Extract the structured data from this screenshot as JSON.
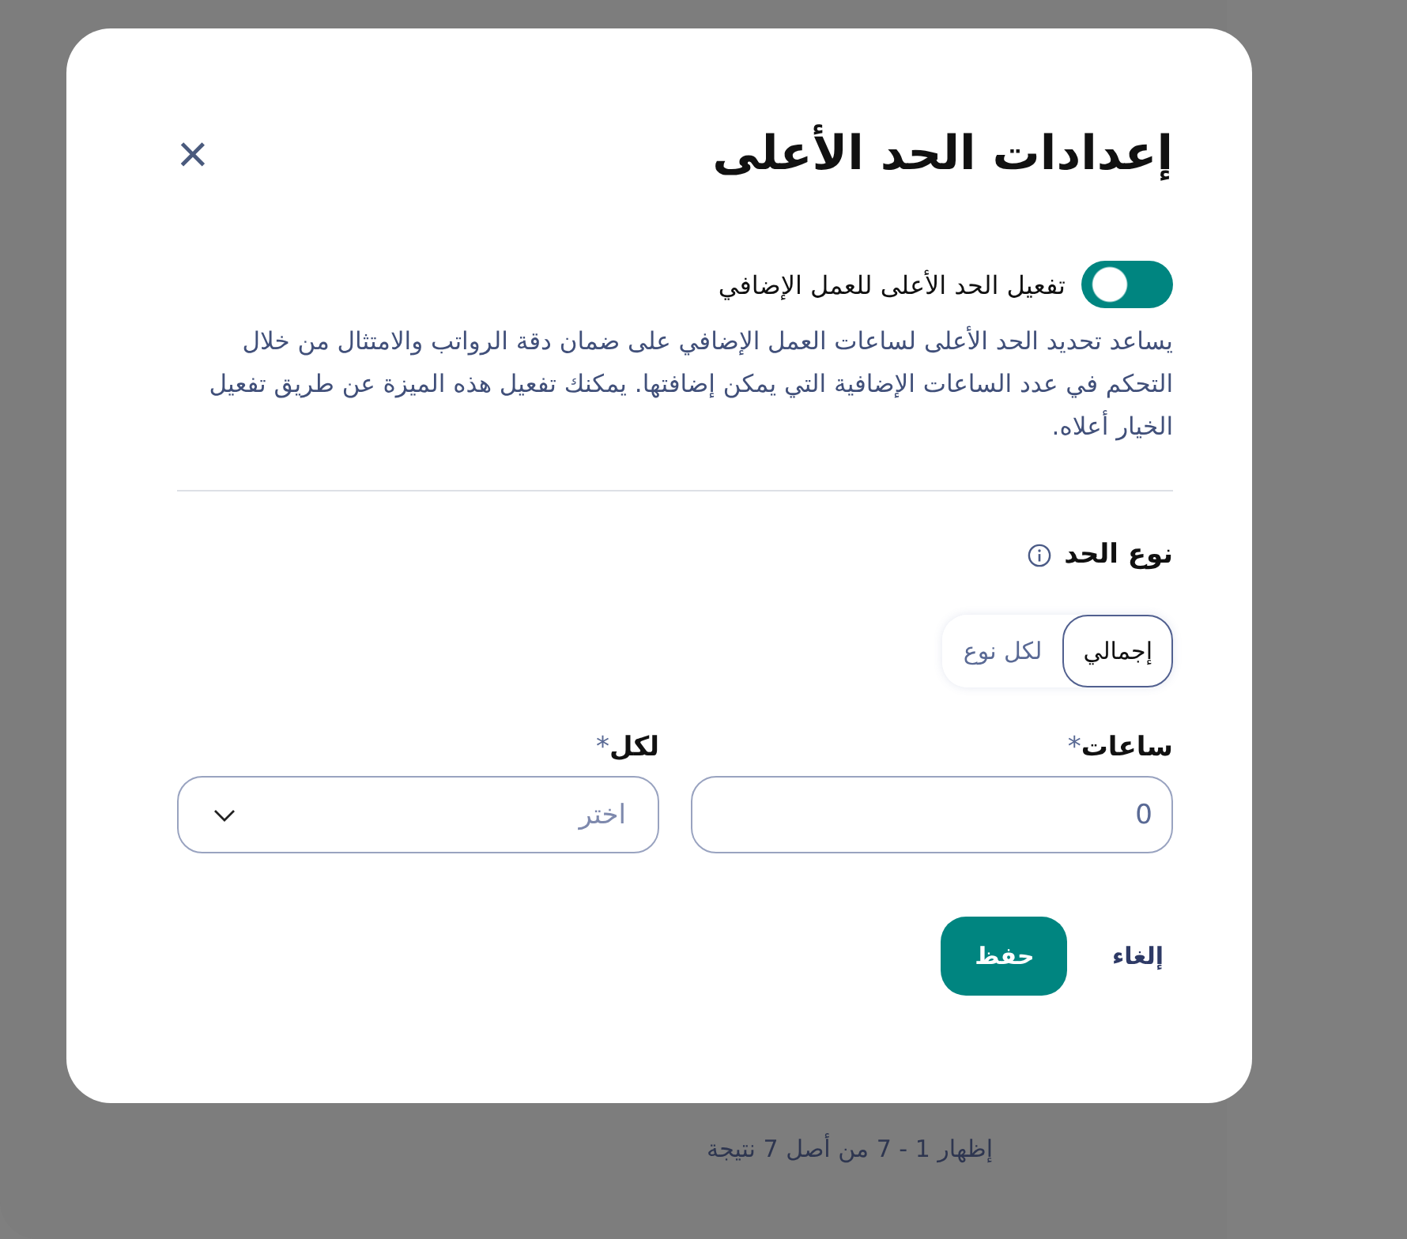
{
  "background": {
    "footer": "إظهار 1 - 7 من أصل 7 نتيجة"
  },
  "dialog": {
    "title": "إعدادات الحد الأعلى",
    "close": "×",
    "toggle": {
      "label": "تفعيل الحد الأعلى للعمل الإضافي",
      "on": true
    },
    "description": "يساعد تحديد الحد الأعلى لساعات العمل الإضافي على ضمان دقة الرواتب والامتثال من خلال التحكم في عدد الساعات الإضافية التي يمكن إضافتها. يمكنك تفعيل هذه الميزة عن طريق تفعيل الخيار أعلاه.",
    "limit_type": {
      "label": "نوع الحد",
      "options": [
        {
          "label": "إجمالي",
          "selected": true
        },
        {
          "label": "لكل نوع",
          "selected": false
        }
      ]
    },
    "fields": [
      {
        "kind": "input",
        "label": "ساعات",
        "required": "*",
        "value": "0"
      },
      {
        "kind": "select",
        "label": "لكل",
        "required": "*",
        "placeholder": "اختر"
      }
    ],
    "buttons": {
      "cancel": "إلغاء",
      "save": "حفظ"
    }
  }
}
